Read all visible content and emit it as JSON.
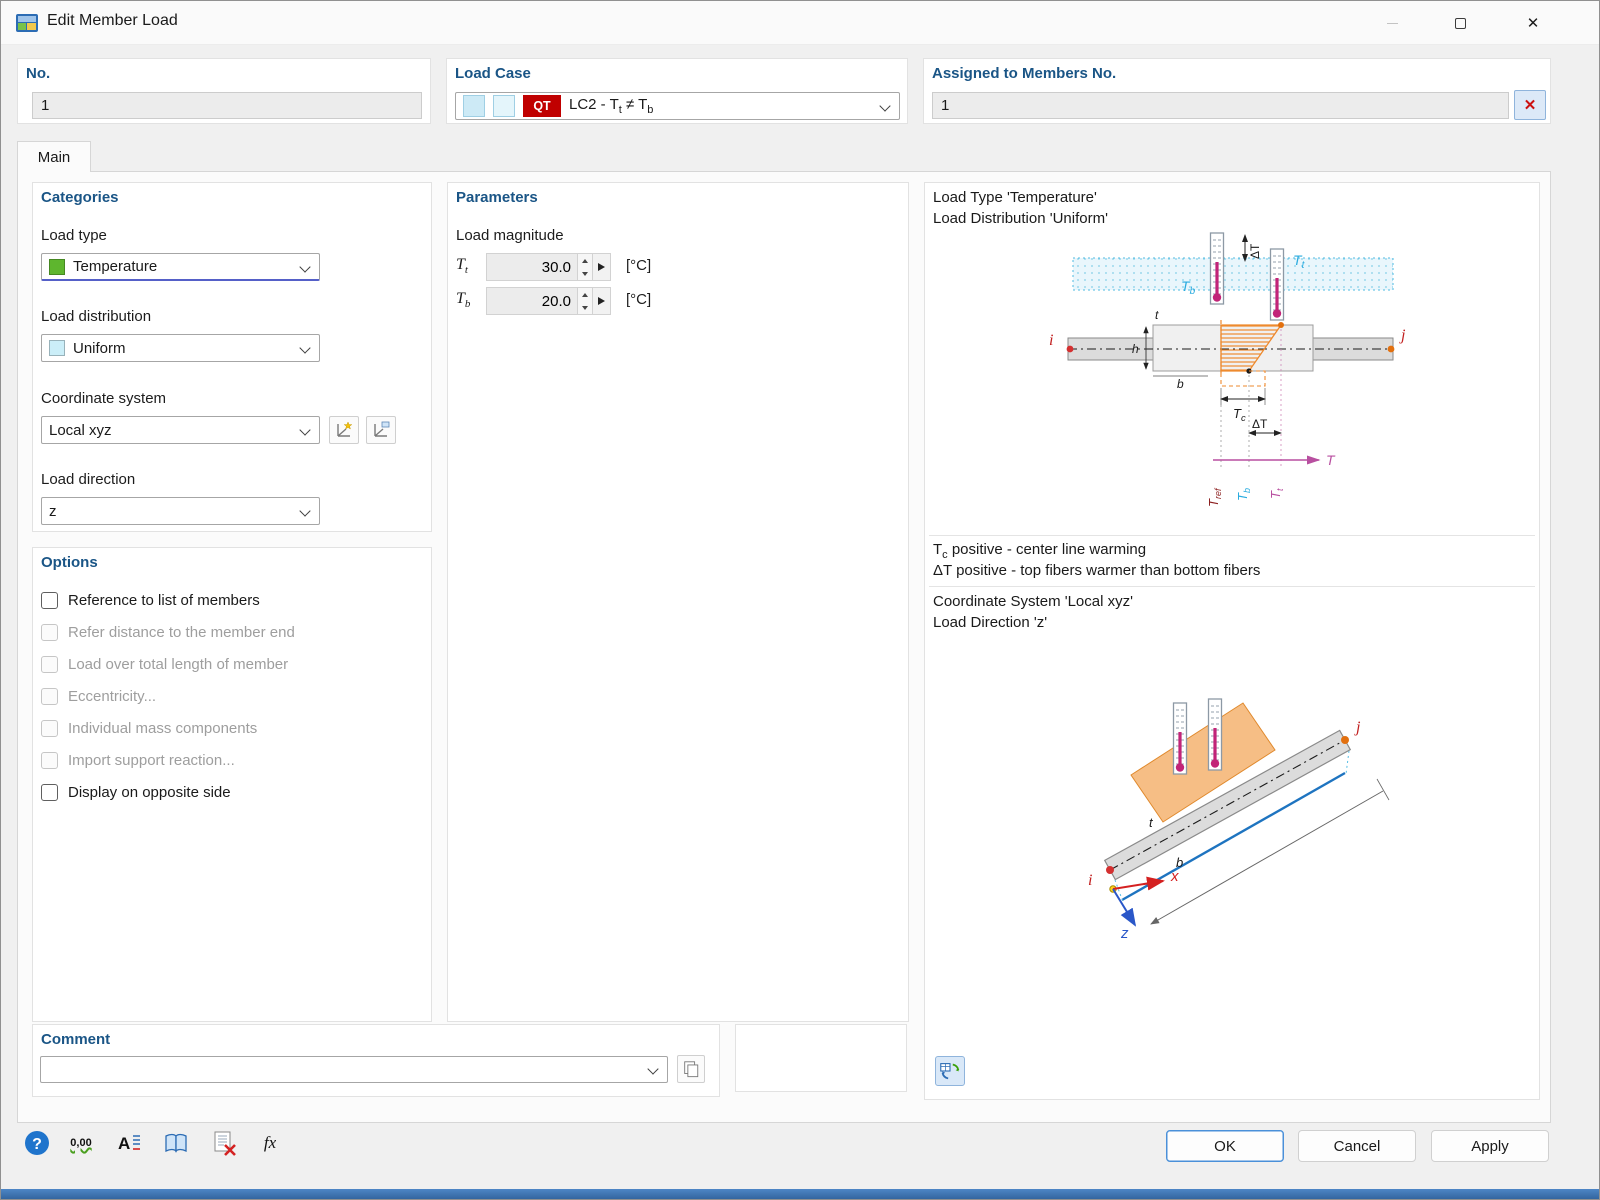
{
  "window": {
    "title": "Edit Member Load"
  },
  "header": {
    "no": {
      "label": "No.",
      "value": "1"
    },
    "load_case": {
      "label": "Load Case",
      "badge": "QT",
      "name_parts": [
        "LC2 - T",
        "t",
        " ≠ T",
        "b"
      ]
    },
    "assigned": {
      "label": "Assigned to Members No.",
      "value": "1"
    }
  },
  "tab": {
    "label": "Main"
  },
  "categories": {
    "title": "Categories",
    "load_type": {
      "label": "Load type",
      "value": "Temperature",
      "color": "#5eb62e"
    },
    "load_distribution": {
      "label": "Load distribution",
      "value": "Uniform",
      "color": "#cbeef8"
    },
    "coordinate_system": {
      "label": "Coordinate system",
      "value": "Local xyz"
    },
    "load_direction": {
      "label": "Load direction",
      "value": "z"
    }
  },
  "options": {
    "title": "Options",
    "items": [
      {
        "label": "Reference to list of members",
        "enabled": true,
        "checked": false
      },
      {
        "label": "Refer distance to the member end",
        "enabled": false,
        "checked": false
      },
      {
        "label": "Load over total length of member",
        "enabled": false,
        "checked": false
      },
      {
        "label": "Eccentricity...",
        "enabled": false,
        "checked": false
      },
      {
        "label": "Individual mass components",
        "enabled": false,
        "checked": false
      },
      {
        "label": "Import support reaction...",
        "enabled": false,
        "checked": false
      },
      {
        "label": "Display on opposite side",
        "enabled": true,
        "checked": false
      }
    ]
  },
  "parameters": {
    "title": "Parameters",
    "group_label": "Load magnitude",
    "fields": [
      {
        "sym": "T",
        "sub": "t",
        "value": "30.0",
        "unit": "[°C]"
      },
      {
        "sym": "T",
        "sub": "b",
        "value": "20.0",
        "unit": "[°C]"
      }
    ]
  },
  "preview": {
    "load_type_line": "Load Type 'Temperature'",
    "load_distribution_line": "Load Distribution 'Uniform'",
    "note1_sym": "T",
    "note1_sub": "c",
    "note1_rest": " positive - center line warming",
    "note2": "ΔT positive - top fibers warmer than bottom fibers",
    "coordinate_line": "Coordinate System 'Local xyz'",
    "direction_line": "Load Direction 'z'"
  },
  "diagram": {
    "i": "i",
    "j": "j",
    "t": "t",
    "b": "b",
    "h": "h",
    "x": "x",
    "z": "z",
    "T": "T",
    "sub_t": "t",
    "sub_b": "b",
    "sub_c": "c",
    "sub_ref": "ref",
    "deltaT": "ΔT"
  },
  "comment": {
    "title": "Comment",
    "value": ""
  },
  "footer": {
    "ok": "OK",
    "cancel": "Cancel",
    "apply": "Apply",
    "help_glyph": "?",
    "units_glyph": "0,00",
    "a_glyph": "A",
    "fx_glyph": "fx"
  },
  "colors": {
    "heading_blue": "#1a5586",
    "focus_underline": "#5560c8",
    "badge_red": "#c00000",
    "ok_border": "#4a90d9"
  }
}
